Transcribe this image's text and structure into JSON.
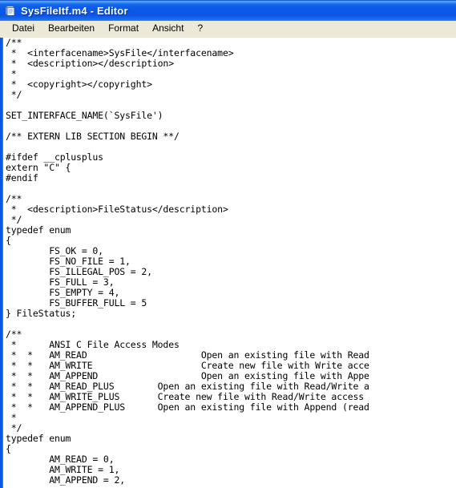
{
  "window": {
    "title": "SysFileItf.m4 - Editor",
    "icon": "notepad-document-icon",
    "titlebar_color": "#0b55e6",
    "titlebar_text_color": "#ffffff",
    "menubar_color": "#ece9d8",
    "client_background": "#ffffff",
    "frame_color": "#0b55e6"
  },
  "menu": {
    "items": [
      {
        "label": "Datei",
        "name": "menu-datei"
      },
      {
        "label": "Bearbeiten",
        "name": "menu-bearbeiten"
      },
      {
        "label": "Format",
        "name": "menu-format"
      },
      {
        "label": "Ansicht",
        "name": "menu-ansicht"
      },
      {
        "label": "?",
        "name": "menu-help"
      }
    ]
  },
  "editor": {
    "font": "monospace",
    "text_color": "#000000",
    "content": "/**\n *  <interfacename>SysFile</interfacename>\n *  <description></description>\n *\n *  <copyright></copyright>\n */\n\nSET_INTERFACE_NAME(`SysFile')\n\n/** EXTERN LIB SECTION BEGIN **/\n\n#ifdef __cplusplus\nextern \"C\" {\n#endif\n\n/**\n *  <description>FileStatus</description>\n */\ntypedef enum\n{\n        FS_OK = 0,\n        FS_NO_FILE = 1,\n        FS_ILLEGAL_POS = 2,\n        FS_FULL = 3,\n        FS_EMPTY = 4,\n        FS_BUFFER_FULL = 5\n} FileStatus;\n\n/**\n *      ANSI C File Access Modes\n *  *   AM_READ                     Open an existing file with Read\n *  *   AM_WRITE                    Create new file with Write acce\n *  *   AM_APPEND                   Open an existing file with Appe\n *  *   AM_READ_PLUS        Open an existing file with Read/Write a\n *  *   AM_WRITE_PLUS       Create new file with Read/Write access \n *  *   AM_APPEND_PLUS      Open an existing file with Append (read\n *\n */\ntypedef enum\n{\n        AM_READ = 0,\n        AM_WRITE = 1,\n        AM_APPEND = 2,"
  }
}
